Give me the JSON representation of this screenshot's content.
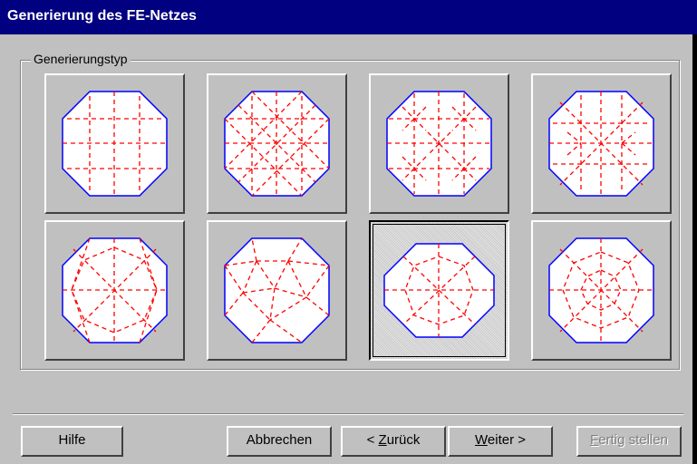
{
  "window": {
    "title": "Generierung des FE-Netzes"
  },
  "group": {
    "label": "Generierungstyp"
  },
  "tiles": [
    {
      "name": "mesh-type-1",
      "selected": false
    },
    {
      "name": "mesh-type-2",
      "selected": false
    },
    {
      "name": "mesh-type-3",
      "selected": false
    },
    {
      "name": "mesh-type-4",
      "selected": false
    },
    {
      "name": "mesh-type-5",
      "selected": false
    },
    {
      "name": "mesh-type-6",
      "selected": false
    },
    {
      "name": "mesh-type-7",
      "selected": true
    },
    {
      "name": "mesh-type-8",
      "selected": false
    }
  ],
  "colors": {
    "outline": "#0000ff",
    "mesh": "#ff0000",
    "fill": "#ffffff",
    "titlebar": "#000080"
  },
  "buttons": {
    "help": "Hilfe",
    "cancel": "Abbrechen",
    "back_prefix": "< ",
    "back_mnemonic": "Z",
    "back_rest": "urück",
    "next_mnemonic": "W",
    "next_rest": "eiter >",
    "finish_mnemonic": "F",
    "finish_rest": "ertig stellen"
  }
}
